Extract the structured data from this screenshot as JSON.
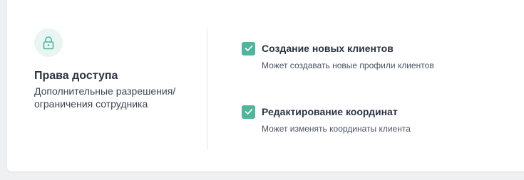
{
  "access": {
    "icon": "lock-icon",
    "title": "Права доступа",
    "description": "Дополнительные разрешения/ ограничения сотрудника"
  },
  "permissions": [
    {
      "checked": true,
      "title": "Создание новых клиентов",
      "description": "Может создавать новые профили клиентов"
    },
    {
      "checked": true,
      "title": "Редактирование координат",
      "description": "Может изменять координаты клиента"
    }
  ],
  "colors": {
    "accent": "#4fb59c",
    "icon_bg": "#e8f5f2",
    "text_dark": "#2b3442"
  }
}
